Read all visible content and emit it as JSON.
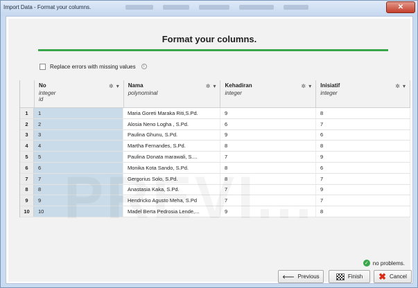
{
  "window": {
    "title": "Import Data - Format your columns.",
    "close_glyph": "✕"
  },
  "heading": "Format your columns.",
  "options": {
    "replace_errors_label": "Replace errors with missing values",
    "info_glyph": "i"
  },
  "columns": [
    {
      "name": "No",
      "type": "integer",
      "role": "id"
    },
    {
      "name": "Nama",
      "type": "polynominal",
      "role": ""
    },
    {
      "name": "Kehadiran",
      "type": "integer",
      "role": ""
    },
    {
      "name": "Inisiatif",
      "type": "integer",
      "role": ""
    }
  ],
  "column_controls": {
    "gear_glyph": "✲",
    "menu_glyph": "▾"
  },
  "rows": [
    {
      "index": "1",
      "cells": [
        "1",
        "Maria Goreti Maraka Riti,S.Pd.",
        "9",
        "8"
      ]
    },
    {
      "index": "2",
      "cells": [
        "2",
        "Alosia Neno Logha , S.Pd.",
        "6",
        "7"
      ]
    },
    {
      "index": "3",
      "cells": [
        "3",
        "Paulina Ghunu, S.Pd.",
        "9",
        "6"
      ]
    },
    {
      "index": "4",
      "cells": [
        "4",
        "Martha Fernandes, S.Pd.",
        "8",
        "8"
      ]
    },
    {
      "index": "5",
      "cells": [
        "5",
        "Paulina Donata marawali, S....",
        "7",
        "9"
      ]
    },
    {
      "index": "6",
      "cells": [
        "6",
        "Monika Kota Sando, S.Pd.",
        "8",
        "6"
      ]
    },
    {
      "index": "7",
      "cells": [
        "7",
        "Gergorius Solo, S.Pd.",
        "8",
        "7"
      ]
    },
    {
      "index": "8",
      "cells": [
        "8",
        "Anastasia Kaka, S.Pd.",
        "7",
        "9"
      ]
    },
    {
      "index": "9",
      "cells": [
        "9",
        "Hendricko Agusto Meha, S.Pd",
        "7",
        "7"
      ]
    },
    {
      "index": "10",
      "cells": [
        "10",
        "Madel Berta Pedrosia Lende,...",
        "9",
        "8"
      ]
    }
  ],
  "watermark": "PREVI...",
  "status": {
    "text": "no problems.",
    "icon_glyph": "✓"
  },
  "buttons": {
    "previous_label": "Previous",
    "finish_label": "Finish",
    "cancel_label": "Cancel",
    "previous_glyph": "⟵",
    "cancel_glyph": "✖"
  },
  "colors": {
    "accent_green": "#3aa84a",
    "id_column": "#c9dbe9",
    "cancel_red": "#d92b16"
  }
}
